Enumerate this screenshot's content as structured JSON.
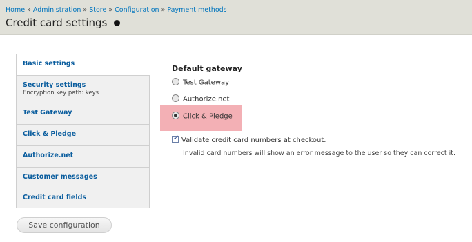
{
  "breadcrumb": [
    {
      "label": "Home"
    },
    {
      "label": "Administration"
    },
    {
      "label": "Store"
    },
    {
      "label": "Configuration"
    },
    {
      "label": "Payment methods"
    }
  ],
  "breadcrumb_separator": "»",
  "page_title": "Credit card settings",
  "tabs": [
    {
      "label": "Basic settings",
      "summary": "",
      "selected": true
    },
    {
      "label": "Security settings",
      "summary": "Encryption key path: keys",
      "selected": false
    },
    {
      "label": "Test Gateway",
      "summary": "",
      "selected": false
    },
    {
      "label": "Click & Pledge",
      "summary": "",
      "selected": false
    },
    {
      "label": "Authorize.net",
      "summary": "",
      "selected": false
    },
    {
      "label": "Customer messages",
      "summary": "",
      "selected": false
    },
    {
      "label": "Credit card fields",
      "summary": "",
      "selected": false
    }
  ],
  "default_gateway": {
    "title": "Default gateway",
    "options": [
      {
        "label": "Test Gateway",
        "checked": false
      },
      {
        "label": "Authorize.net",
        "checked": false
      },
      {
        "label": "Click & Pledge",
        "checked": true,
        "highlighted": true
      }
    ]
  },
  "validate": {
    "label": "Validate credit card numbers at checkout.",
    "checked": true,
    "description": "Invalid card numbers will show an error message to the user so they can correct it."
  },
  "actions": {
    "save_label": "Save configuration"
  },
  "colors": {
    "header_bg": "#e0e0d8",
    "link": "#0074bd",
    "highlight": "#f3b0b5"
  }
}
